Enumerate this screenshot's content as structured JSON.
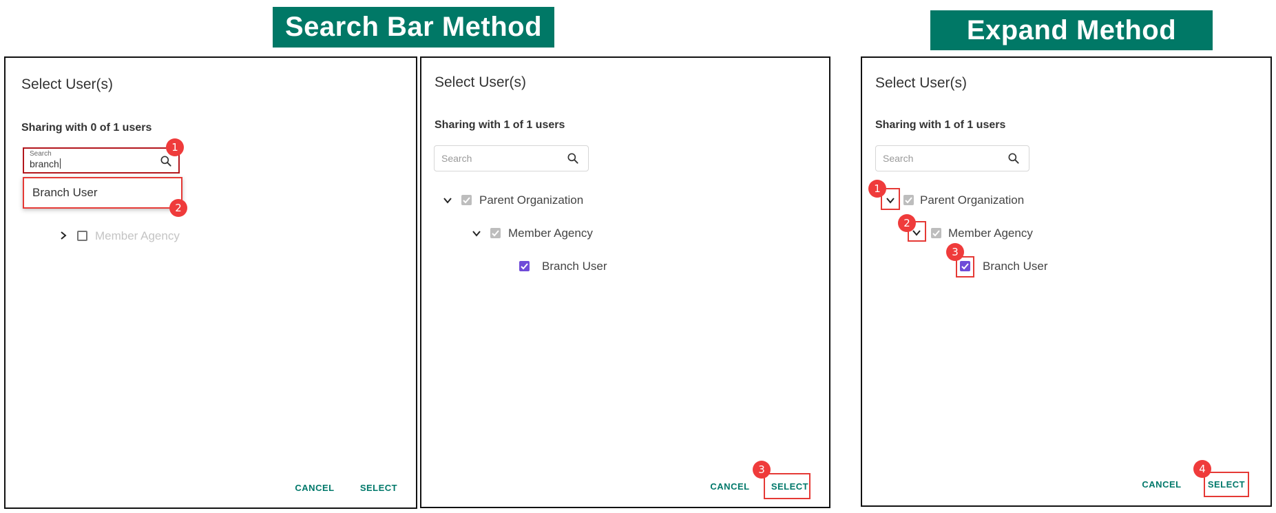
{
  "banners": {
    "search_bar": "Search Bar Method",
    "expand": "Expand Method"
  },
  "colors": {
    "banner_bg": "#007866",
    "button_text": "#00786a",
    "checkbox_checked": "#6f4bd8",
    "checkbox_inherited": "#bdbdbd",
    "highlight": "#e53935",
    "badge": "#ef3b3b"
  },
  "panel1": {
    "title": "Select User(s)",
    "sharing": "Sharing with 0 of 1 users",
    "search_label": "Search",
    "search_value": "branch",
    "dropdown_option": "Branch User",
    "tree_member": "Member Agency",
    "cancel": "CANCEL",
    "select": "SELECT",
    "badges": [
      "1",
      "2"
    ]
  },
  "panel2": {
    "title": "Select User(s)",
    "sharing": "Sharing with 1 of 1 users",
    "search_placeholder": "Search",
    "tree": [
      "Parent Organization",
      "Member Agency",
      "Branch User"
    ],
    "cancel": "CANCEL",
    "select": "SELECT",
    "badges": [
      "3"
    ]
  },
  "panel3": {
    "title": "Select User(s)",
    "sharing": "Sharing with 1 of 1 users",
    "search_placeholder": "Search",
    "tree": [
      "Parent Organization",
      "Member Agency",
      "Branch User"
    ],
    "cancel": "CANCEL",
    "select": "SELECT",
    "badges": [
      "1",
      "2",
      "3",
      "4"
    ]
  },
  "icons": [
    "search-icon",
    "chevron-down-icon",
    "chevron-right-icon",
    "check-icon"
  ]
}
